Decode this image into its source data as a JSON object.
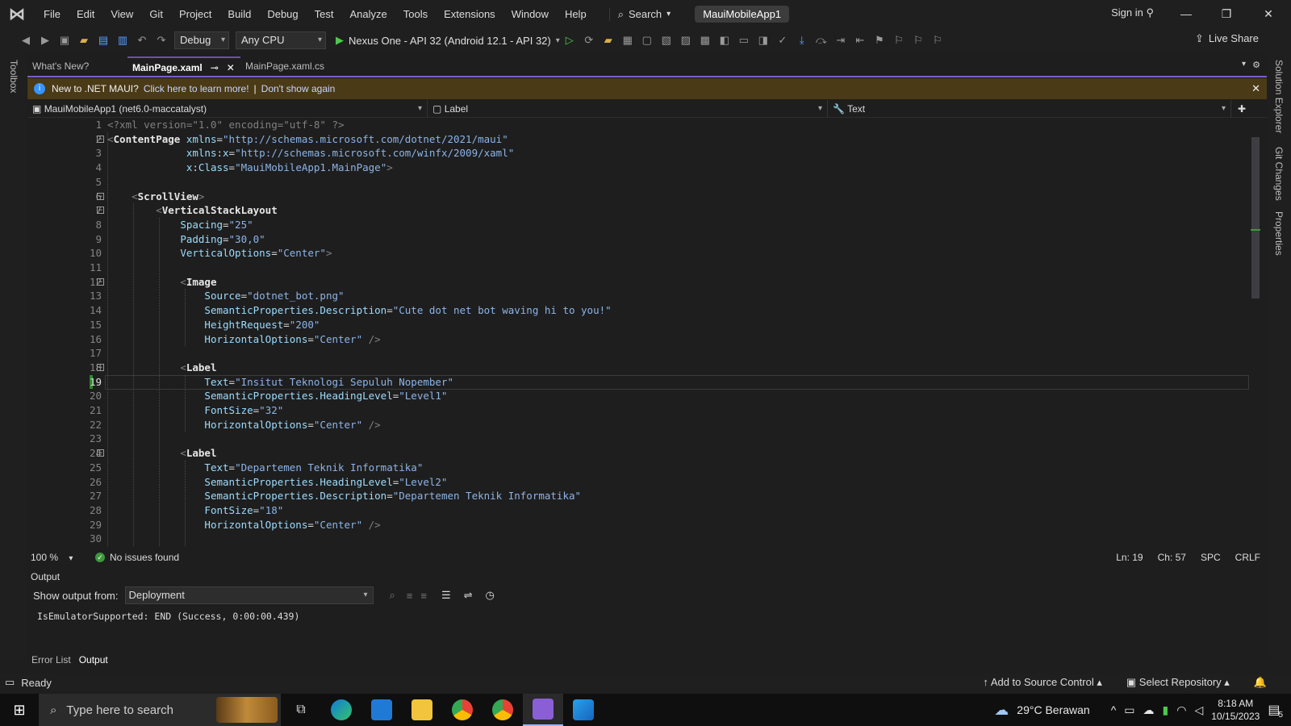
{
  "menubar": {
    "items": [
      "File",
      "Edit",
      "View",
      "Git",
      "Project",
      "Build",
      "Debug",
      "Test",
      "Analyze",
      "Tools",
      "Extensions",
      "Window",
      "Help"
    ],
    "search_label": "Search",
    "solution_name": "MauiMobileApp1",
    "sign_in": "Sign in"
  },
  "toolbar": {
    "configuration": "Debug",
    "platform": "Any CPU",
    "run_target": "Nexus One - API 32 (Android 12.1 - API 32)",
    "live_share": "Live Share"
  },
  "side_panels": {
    "left": "Toolbox",
    "right": [
      "Solution Explorer",
      "Git Changes",
      "Properties"
    ]
  },
  "tabs": [
    {
      "label": "What's New?",
      "active": false
    },
    {
      "label": "MainPage.xaml",
      "active": true
    },
    {
      "label": "MainPage.xaml.cs",
      "active": false
    }
  ],
  "infobar": {
    "message": "New to .NET MAUI?",
    "link": "Click here to learn more!",
    "separator": "|",
    "dismiss": "Don't show again"
  },
  "navbar": {
    "project": "MauiMobileApp1 (net6.0-maccatalyst)",
    "element": "Label",
    "member": "Text"
  },
  "editor": {
    "current_line": 19,
    "lines": [
      "<?xml version=\"1.0\" encoding=\"utf-8\" ?>",
      "<ContentPage xmlns=\"http://schemas.microsoft.com/dotnet/2021/maui\"",
      "             xmlns:x=\"http://schemas.microsoft.com/winfx/2009/xaml\"",
      "             x:Class=\"MauiMobileApp1.MainPage\">",
      "",
      "    <ScrollView>",
      "        <VerticalStackLayout",
      "            Spacing=\"25\"",
      "            Padding=\"30,0\"",
      "            VerticalOptions=\"Center\">",
      "",
      "            <Image",
      "                Source=\"dotnet_bot.png\"",
      "                SemanticProperties.Description=\"Cute dot net bot waving hi to you!\"",
      "                HeightRequest=\"200\"",
      "                HorizontalOptions=\"Center\" />",
      "",
      "            <Label",
      "                Text=\"Insitut Teknologi Sepuluh Nopember\"",
      "                SemanticProperties.HeadingLevel=\"Level1\"",
      "                FontSize=\"32\"",
      "                HorizontalOptions=\"Center\" />",
      "",
      "            <Label",
      "                Text=\"Departemen Teknik Informatika\"",
      "                SemanticProperties.HeadingLevel=\"Level2\"",
      "                SemanticProperties.Description=\"Departemen Teknik Informatika\"",
      "                FontSize=\"18\"",
      "                HorizontalOptions=\"Center\" />",
      ""
    ]
  },
  "editor_status": {
    "zoom": "100 %",
    "issues": "No issues found",
    "line": "Ln: 19",
    "column": "Ch: 57",
    "whitespace": "SPC",
    "line_ending": "CRLF"
  },
  "output": {
    "title": "Output",
    "show_from_label": "Show output from:",
    "source": "Deployment",
    "text": "IsEmulatorSupported: END (Success, 0:00:00.439)"
  },
  "bottom_tabs": [
    {
      "label": "Error List",
      "active": false
    },
    {
      "label": "Output",
      "active": true
    }
  ],
  "statusbar": {
    "state": "Ready",
    "source_control": "Add to Source Control",
    "repository": "Select Repository"
  },
  "taskbar": {
    "search_placeholder": "Type here to search",
    "weather": "29°C  Berawan",
    "time": "8:18 AM",
    "date": "10/15/2023",
    "notification_count": "5"
  }
}
